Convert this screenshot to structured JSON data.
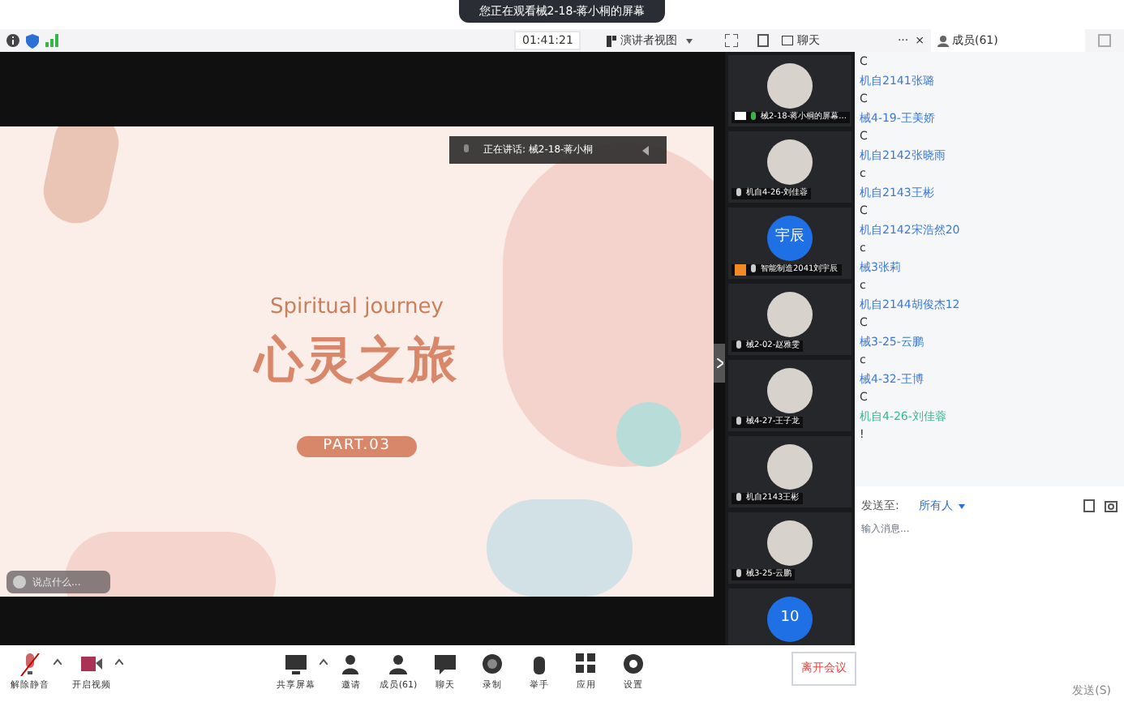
{
  "banner": {
    "text": "您正在观看械2-18-蒋小桐的屏幕"
  },
  "topbar": {
    "timer": "01:41:21",
    "view": "演讲者视图",
    "chat_tab": "聊天",
    "more": "···",
    "close": "×",
    "members_tab": "成员(61)"
  },
  "slide": {
    "subtitle": "Spiritual journey",
    "title": "心灵之旅",
    "part": "PART.03"
  },
  "speaking": {
    "text": "正在讲话: 械2-18-蒋小桐"
  },
  "comment_pill": {
    "placeholder": "说点什么..."
  },
  "videos": [
    {
      "name": "械2-18-蒋小桐的屏幕...",
      "kind": "photo",
      "sharing": true
    },
    {
      "name": "机自4-26-刘佳蓉",
      "kind": "photo",
      "sharing": false
    },
    {
      "name": "智能制造2041刘宇辰",
      "kind": "initials",
      "initials": "宇辰",
      "sharing": false,
      "host": true
    },
    {
      "name": "械2-02-赵雅雯",
      "kind": "photo",
      "sharing": false
    },
    {
      "name": "械4-27-王子龙",
      "kind": "photo",
      "sharing": false
    },
    {
      "name": "机自2143王彬",
      "kind": "photo",
      "sharing": false
    },
    {
      "name": "械3-25-云鹏",
      "kind": "photo",
      "sharing": false
    },
    {
      "kind": "initials",
      "initials": "10",
      "sharing": false
    }
  ],
  "chat": {
    "messages": [
      {
        "text": "C",
        "kind": "message"
      },
      {
        "text": "机自2141张璐",
        "kind": "sender"
      },
      {
        "text": "C",
        "kind": "message"
      },
      {
        "text": "械4-19-王美娇",
        "kind": "sender"
      },
      {
        "text": "C",
        "kind": "message"
      },
      {
        "text": "机自2142张晓雨",
        "kind": "sender"
      },
      {
        "text": "c",
        "kind": "message"
      },
      {
        "text": "机自2143王彬",
        "kind": "sender"
      },
      {
        "text": "C",
        "kind": "message"
      },
      {
        "text": "机自2142宋浩然20",
        "kind": "sender"
      },
      {
        "text": "c",
        "kind": "message"
      },
      {
        "text": "械3张莉",
        "kind": "sender"
      },
      {
        "text": "c",
        "kind": "message"
      },
      {
        "text": "机自2144胡俊杰12",
        "kind": "sender"
      },
      {
        "text": "C",
        "kind": "message"
      },
      {
        "text": "械3-25-云鹏",
        "kind": "sender"
      },
      {
        "text": "c",
        "kind": "message"
      },
      {
        "text": "械4-32-王博",
        "kind": "sender"
      },
      {
        "text": "C",
        "kind": "message"
      },
      {
        "text": "机自4-26-刘佳蓉",
        "kind": "self"
      },
      {
        "text": "!",
        "kind": "message"
      }
    ],
    "send_to_label": "发送至:",
    "send_to": "所有人",
    "input_placeholder": "输入消息...",
    "send": "发送(S)"
  },
  "toolbar": [
    {
      "label": "解除静音",
      "caret": true
    },
    {
      "label": "开启视频",
      "caret": true
    },
    {
      "label": "共享屏幕",
      "caret": true
    },
    {
      "label": "邀请",
      "caret": false
    },
    {
      "label": "成员(61)",
      "caret": false
    },
    {
      "label": "聊天",
      "caret": false
    },
    {
      "label": "录制",
      "caret": false
    },
    {
      "label": "举手",
      "caret": false
    },
    {
      "label": "应用",
      "caret": false
    },
    {
      "label": "设置",
      "caret": false
    }
  ],
  "leave": "离开会议"
}
